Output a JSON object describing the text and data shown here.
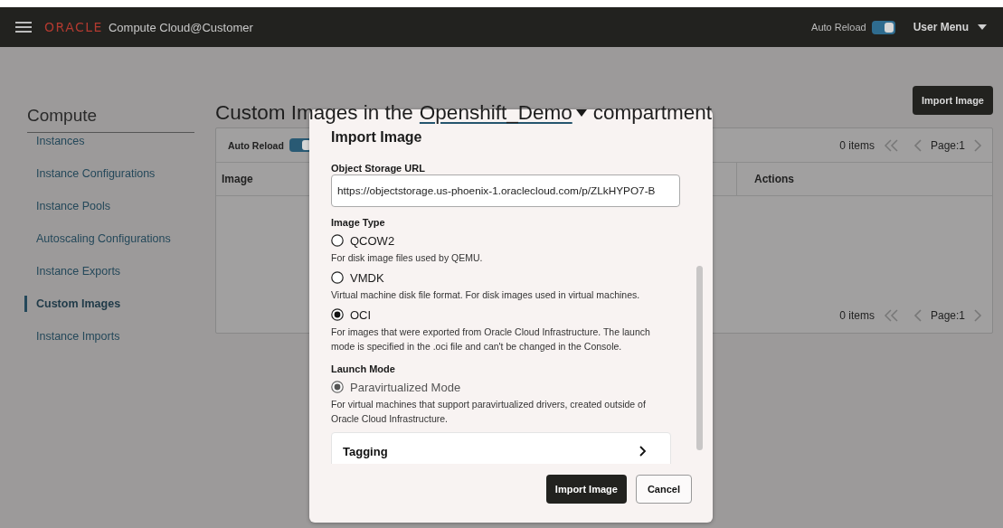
{
  "header": {
    "brand": "ORACLE",
    "product": "Compute Cloud@Customer",
    "auto_reload": {
      "label": "Auto Reload",
      "on": true
    },
    "user_menu": "User Menu"
  },
  "sidebar": {
    "title": "Compute",
    "items": [
      {
        "label": "Instances",
        "selected": false
      },
      {
        "label": "Instance Configurations",
        "selected": false
      },
      {
        "label": "Instance Pools",
        "selected": false
      },
      {
        "label": "Autoscaling Configurations",
        "selected": false
      },
      {
        "label": "Instance Exports",
        "selected": false
      },
      {
        "label": "Custom Images",
        "selected": true
      },
      {
        "label": "Instance Imports",
        "selected": false
      }
    ]
  },
  "page_title": {
    "prefix": "Custom Images in the",
    "compartment": "Openshift_Demo",
    "suffix": "compartment"
  },
  "import_button": "Import Image",
  "table": {
    "auto_reload": {
      "label": "Auto Reload",
      "on": true
    },
    "items_count": "0 items",
    "page": "Page:1",
    "columns": [
      "Image",
      "Actions"
    ],
    "footer_items_count": "0 items",
    "footer_page": "Page:1"
  },
  "dialog": {
    "title": "Import Image",
    "url_field": {
      "label": "Object Storage URL",
      "value": "https://objectstorage.us-phoenix-1.oraclecloud.com/p/ZLkHYPO7-B"
    },
    "image_type": {
      "label": "Image Type",
      "options": [
        {
          "label": "QCOW2",
          "description": "For disk image files used by QEMU.",
          "selected": false
        },
        {
          "label": "VMDK",
          "description": "Virtual machine disk file format. For disk images used in virtual machines.",
          "selected": false
        },
        {
          "label": "OCI",
          "description": "For images that were exported from Oracle Cloud Infrastructure. The launch mode is specified in the .oci file and can't be changed in the Console.",
          "selected": true
        }
      ]
    },
    "launch_mode": {
      "label": "Launch Mode",
      "options": [
        {
          "label": "Paravirtualized Mode",
          "description": "For virtual machines that support paravirtualized drivers, created outside of Oracle Cloud Infrastructure.",
          "selected": true,
          "disabled": true
        }
      ]
    },
    "tagging": "Tagging",
    "buttons": [
      {
        "label": "Import Image",
        "kind": "primary"
      },
      {
        "label": "Cancel",
        "kind": "secondary"
      }
    ]
  }
}
